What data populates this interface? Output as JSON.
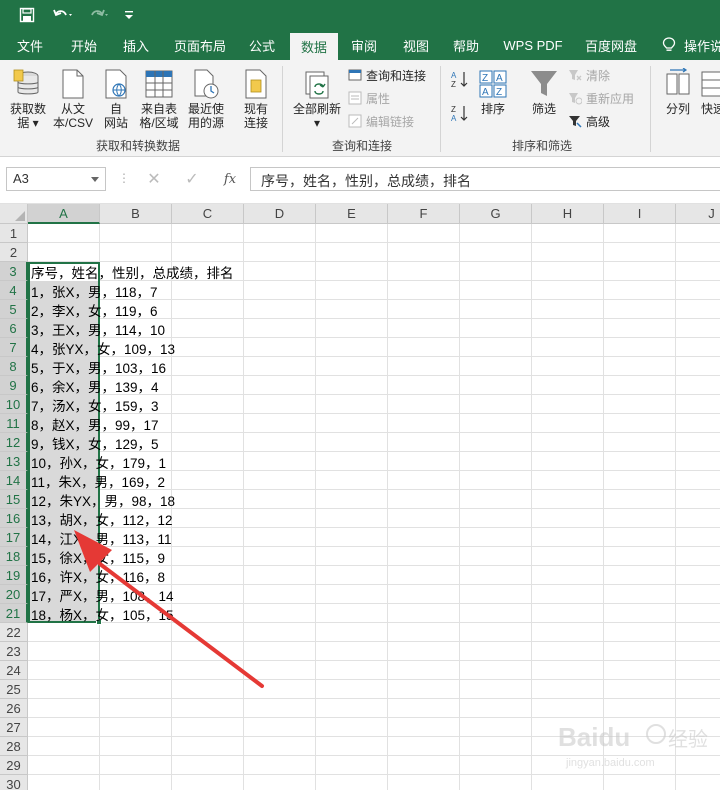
{
  "qat": {
    "save_icon": "save-icon",
    "undo_icon": "undo-icon",
    "redo_icon": "redo-icon",
    "customize_icon": "customize-qat-icon"
  },
  "tabs": [
    {
      "label": "文件"
    },
    {
      "label": "开始"
    },
    {
      "label": "插入"
    },
    {
      "label": "页面布局"
    },
    {
      "label": "公式"
    },
    {
      "label": "数据"
    },
    {
      "label": "审阅"
    },
    {
      "label": "视图"
    },
    {
      "label": "帮助"
    },
    {
      "label": "WPS PDF"
    },
    {
      "label": "百度网盘"
    },
    {
      "label": "操作说"
    }
  ],
  "active_tab": "数据",
  "ribbon": {
    "groups": {
      "get_transform": "获取和转换数据",
      "queries": "查询和连接",
      "sort_filter": "排序和筛选"
    },
    "buttons": {
      "get_data_1": "获取数",
      "get_data_2": "据",
      "from_csv_1": "从文",
      "from_csv_2": "本/CSV",
      "from_web_1": "自",
      "from_web_2": "网站",
      "from_table_1": "来自表",
      "from_table_2": "格/区域",
      "recent_1": "最近使",
      "recent_2": "用的源",
      "existing_1": "现有",
      "existing_2": "连接",
      "refresh_all": "全部刷新",
      "queries_connections": "查询和连接",
      "properties": "属性",
      "edit_links": "编辑链接",
      "sort": "排序",
      "filter": "筛选",
      "clear": "清除",
      "reapply": "重新应用",
      "advanced": "高级",
      "split": "分列",
      "quick": "快速"
    }
  },
  "formula_bar": {
    "name_box": "A3",
    "content": "序号，姓名，性别，总成绩，排名"
  },
  "columns": [
    "A",
    "B",
    "C",
    "D",
    "E",
    "F",
    "G",
    "H",
    "I",
    "J"
  ],
  "rows": [
    "1",
    "2",
    "3",
    "4",
    "5",
    "6",
    "7",
    "8",
    "9",
    "10",
    "11",
    "12",
    "13",
    "14",
    "15",
    "16",
    "17",
    "18",
    "19",
    "20",
    "21",
    "22",
    "23",
    "24",
    "25",
    "26",
    "27",
    "28",
    "29",
    "30"
  ],
  "cells": {
    "r3": "序号，姓名，性别，总成绩，排名",
    "r4": "1，张X，男，118，7",
    "r5": "2，李X，女，119，6",
    "r6": "3，王X，男，114，10",
    "r7": "4，张YX，女，109，13",
    "r8": "5，于X，男，103，16",
    "r9": "6，余X，男，139，4",
    "r10": "7，汤X，女，159，3",
    "r11": "8，赵X，男，99，17",
    "r12": "9，钱X，女，129，5",
    "r13": "10，孙X，女，179，1",
    "r14": "11，朱X，男，169，2",
    "r15": "12，朱YX，男，98，18",
    "r16": "13，胡X，女，112，12",
    "r17": "14，江X，男，113，11",
    "r18": "15，徐X，女，115，9",
    "r19": "16，许X，女，116，8",
    "r20": "17，严X，男，108，14",
    "r21": "18，杨X，女，105，15"
  },
  "colors": {
    "excel_green": "#217346",
    "arrow_red": "#e53935"
  },
  "watermark": {
    "brand": "Baidu",
    "sub": "经验",
    "url": "jingyan.baidu.com"
  }
}
